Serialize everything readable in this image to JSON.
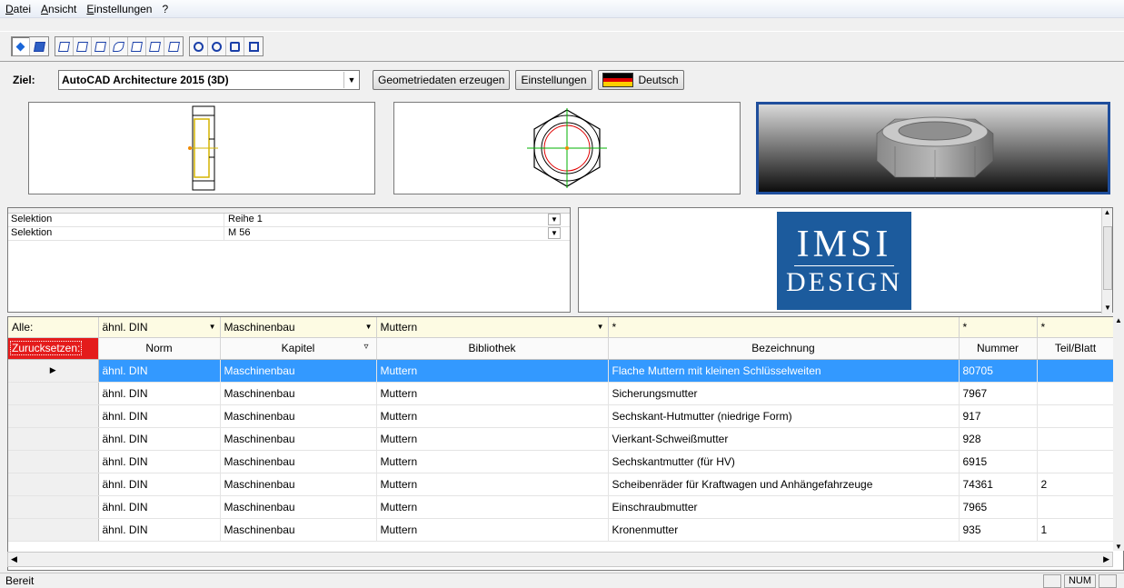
{
  "menu": [
    "Datei",
    "Ansicht",
    "Einstellungen",
    "?"
  ],
  "toolbar": {
    "icons": [
      "point-icon",
      "render-cube-icon",
      "view-front-icon",
      "view-top-icon",
      "view-left-icon",
      "view-iso-icon",
      "view-right-icon",
      "view-back-icon",
      "view-bottom-icon",
      "zoom-in-icon",
      "zoom-out-icon",
      "zoom-window-icon",
      "zoom-all-icon"
    ]
  },
  "target": {
    "label": "Ziel:",
    "value": "AutoCAD Architecture 2015 (3D)",
    "generate_button": "Geometriedaten erzeugen",
    "settings_button": "Einstellungen",
    "language_button": "Deutsch"
  },
  "properties": [
    {
      "key": "Selektion",
      "value": "Reihe 1"
    },
    {
      "key": "Selektion",
      "value": "M 56"
    }
  ],
  "logo": {
    "line1": "IMSI",
    "line2": "DESIGN"
  },
  "filter": {
    "label": "Alle:",
    "norm": "ähnl. DIN",
    "kapitel": "Maschinenbau",
    "bibliothek": "Muttern",
    "bezeichnung": "*",
    "nummer": "*",
    "teil": "*"
  },
  "columns": {
    "reset": "Zurucksetzen:",
    "norm": "Norm",
    "kapitel": "Kapitel",
    "bibliothek": "Bibliothek",
    "bezeichnung": "Bezeichnung",
    "nummer": "Nummer",
    "teil": "Teil/Blatt"
  },
  "rows": [
    {
      "norm": "ähnl. DIN",
      "kapitel": "Maschinenbau",
      "bibliothek": "Muttern",
      "bezeichnung": "Flache Muttern mit kleinen Schlüsselweiten",
      "nummer": "80705",
      "teil": ""
    },
    {
      "norm": "ähnl. DIN",
      "kapitel": "Maschinenbau",
      "bibliothek": "Muttern",
      "bezeichnung": "Sicherungsmutter",
      "nummer": "7967",
      "teil": ""
    },
    {
      "norm": "ähnl. DIN",
      "kapitel": "Maschinenbau",
      "bibliothek": "Muttern",
      "bezeichnung": "Sechskant-Hutmutter (niedrige Form)",
      "nummer": "917",
      "teil": ""
    },
    {
      "norm": "ähnl. DIN",
      "kapitel": "Maschinenbau",
      "bibliothek": "Muttern",
      "bezeichnung": "Vierkant-Schweißmutter",
      "nummer": "928",
      "teil": ""
    },
    {
      "norm": "ähnl. DIN",
      "kapitel": "Maschinenbau",
      "bibliothek": "Muttern",
      "bezeichnung": "Sechskantmutter (für HV)",
      "nummer": "6915",
      "teil": ""
    },
    {
      "norm": "ähnl. DIN",
      "kapitel": "Maschinenbau",
      "bibliothek": "Muttern",
      "bezeichnung": "Scheibenräder für Kraftwagen und Anhängefahrzeuge",
      "nummer": "74361",
      "teil": "2"
    },
    {
      "norm": "ähnl. DIN",
      "kapitel": "Maschinenbau",
      "bibliothek": "Muttern",
      "bezeichnung": "Einschraubmutter",
      "nummer": "7965",
      "teil": ""
    },
    {
      "norm": "ähnl. DIN",
      "kapitel": "Maschinenbau",
      "bibliothek": "Muttern",
      "bezeichnung": "Kronenmutter",
      "nummer": "935",
      "teil": "1"
    }
  ],
  "status": {
    "text": "Bereit",
    "num": "NUM"
  },
  "colors": {
    "selection": "#3399ff",
    "reset": "#e41b1b",
    "logo_bg": "#1c5b9d",
    "render_border": "#1f4e9c"
  }
}
